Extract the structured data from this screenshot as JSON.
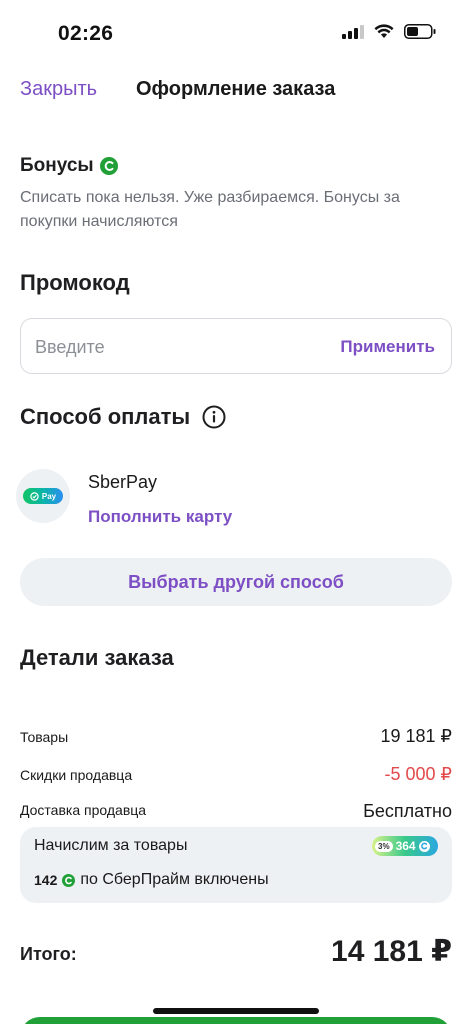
{
  "status_bar": {
    "time": "02:26"
  },
  "nav": {
    "close_label": "Закрыть",
    "title": "Оформление заказа"
  },
  "bonuses": {
    "title": "Бонусы",
    "description": "Списать пока нельзя. Уже разбираемся. Бонусы за покупки начисляются"
  },
  "promo": {
    "title": "Промокод",
    "placeholder": "Введите",
    "value": "",
    "apply_label": "Применить"
  },
  "payment": {
    "title": "Способ оплаты",
    "method_name": "SberPay",
    "logo_text": "Pay",
    "topup_label": "Пополнить карту",
    "other_method_label": "Выбрать другой способ"
  },
  "details": {
    "title": "Детали заказа",
    "rows": [
      {
        "label": "Товары",
        "value": "19 181 ₽"
      },
      {
        "label": "Скидки продавца",
        "value": "-5 000 ₽"
      },
      {
        "label": "Доставка продавца",
        "value": "Бесплатно"
      }
    ],
    "accrual": {
      "label": "Начислим за товары",
      "badge_percent": "3%",
      "badge_value": "364",
      "prime_count": "142",
      "prime_text": "по СберПрайм включены"
    }
  },
  "total": {
    "label": "Итого:",
    "value": "14 181 ₽"
  },
  "colors": {
    "accent": "#7d4fc4",
    "sber_green": "#21a038",
    "discount_red": "#e2494b"
  },
  "icons": [
    "signal-icon",
    "wifi-icon",
    "battery-icon",
    "sber-coin-icon",
    "info-icon",
    "sberpay-logo"
  ]
}
